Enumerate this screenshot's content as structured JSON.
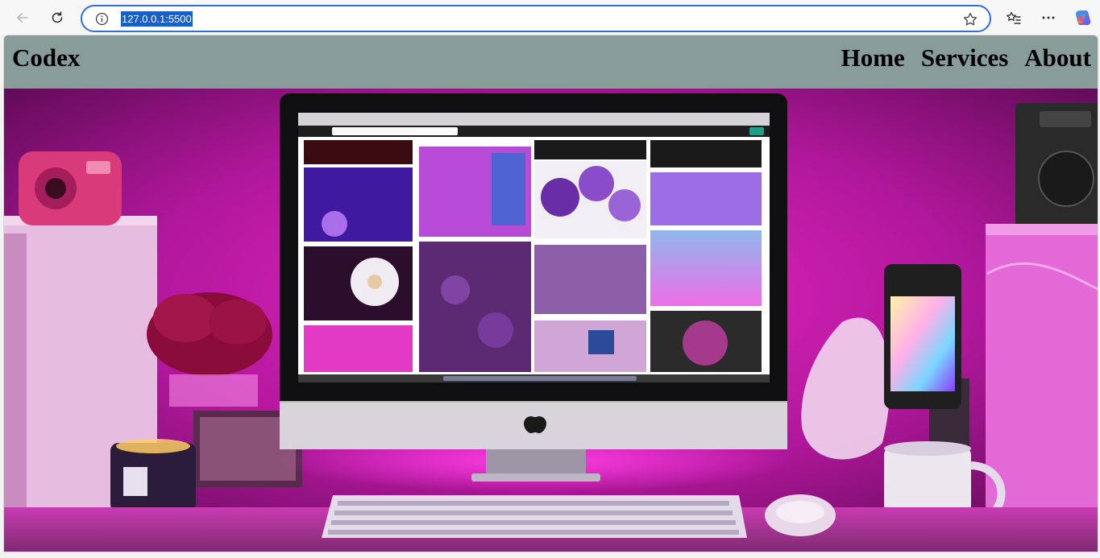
{
  "browser": {
    "url": "127.0.0.1:5500",
    "icons": [
      "back-arrow-icon",
      "reload-icon",
      "info-icon",
      "favorite-star-icon",
      "favorites-list-icon",
      "more-icon",
      "copilot-icon"
    ],
    "accent": "#2f6fd8"
  },
  "navbar": {
    "brand": "Codex",
    "links": [
      "Home",
      "Services",
      "About"
    ],
    "background": "#889c9a"
  },
  "hero": {
    "image": "desk-setup-with-monitor-photo",
    "tint": "#d81cc0"
  }
}
